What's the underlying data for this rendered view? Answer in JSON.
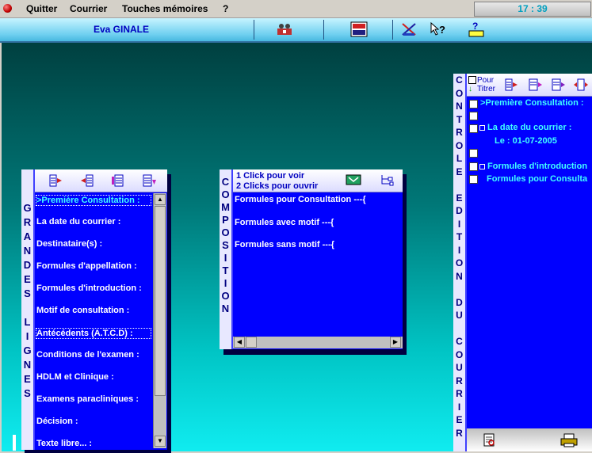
{
  "menu": {
    "quitter": "Quitter",
    "courrier": "Courrier",
    "touches": "Touches mémoires",
    "help": "?"
  },
  "clock": "17 : 39",
  "toolbar": {
    "patient_name": "Eva  GINALE",
    "icons": [
      "reunion-icon",
      "alpha-face-icon",
      "cross-tool-icon",
      "what-is-icon",
      "aide-rapide-icon"
    ]
  },
  "grandes_lignes": {
    "title_letters": [
      "G",
      "R",
      "A",
      "N",
      "D",
      "E",
      "S",
      "",
      "L",
      "I",
      "G",
      "N",
      "E",
      "S"
    ],
    "items": [
      ">Première Consultation :",
      "La date du courrier :",
      "Destinataire(s) :",
      "Formules d'appellation :",
      "Formules d'introduction :",
      "Motif de consultation :",
      "Antécédents (A.T.C.D) :",
      "Conditions de l'examen :",
      "HDLM et Clinique :",
      "Examens paracliniques :",
      "Décision :",
      "Texte libre... :"
    ]
  },
  "composition": {
    "title_letters": [
      "C",
      "O",
      "M",
      "P",
      "O",
      "S",
      "I",
      "T",
      "I",
      "O",
      "N"
    ],
    "hint_line1": "1 Click pour voir",
    "hint_line2": "2 Clicks pour ouvrir",
    "items": [
      "Formules pour Consultation ---{",
      "Formules avec motif ---{",
      "Formules sans motif ---{"
    ]
  },
  "controle": {
    "title_letters": [
      "C",
      "O",
      "N",
      "T",
      "R",
      "O",
      "L",
      "E",
      "",
      "E",
      "D",
      "I",
      "T",
      "I",
      "O",
      "N",
      "",
      "D",
      "U",
      "",
      "C",
      "O",
      "U",
      "R",
      "R",
      "I",
      "E",
      "R"
    ],
    "pour_titrer_1": "Pour",
    "pour_titrer_2": "Titrer",
    "lines": [
      ">Première Consultation :",
      "",
      "La date du courrier :",
      "Le : 01-07-2005",
      "",
      "Formules d'introduction",
      "Formules pour Consulta"
    ]
  }
}
